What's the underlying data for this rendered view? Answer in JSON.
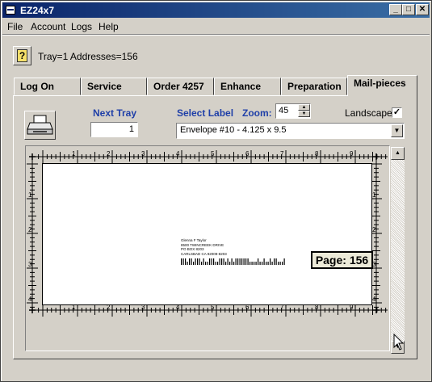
{
  "window": {
    "title": "EZ24x7",
    "controls": {
      "minimize": "_",
      "maximize": "□",
      "close": "✕"
    }
  },
  "menu": {
    "items": [
      "File",
      "Account",
      "Logs",
      "Help"
    ]
  },
  "status": {
    "text": "Tray=1 Addresses=156"
  },
  "tabs": [
    "Log On",
    "Service",
    "Order 4257",
    "Enhance",
    "Preparation",
    "Mail-pieces"
  ],
  "active_tab": "Mail-pieces",
  "controls": {
    "next_tray_label": "Next Tray",
    "next_tray_value": "1",
    "select_label": "Select Label",
    "zoom_label": "Zoom:",
    "zoom_value": "45",
    "landscape_label": "Landscape",
    "landscape_checked": true,
    "label_option": "Envelope #10  - 4.125 x 9.5"
  },
  "ruler": {
    "top_numbers": [
      "1",
      "2",
      "3",
      "4",
      "5",
      "6",
      "7",
      "8",
      "9"
    ],
    "side_numbers": [
      "1",
      "2",
      "3",
      "4"
    ]
  },
  "address": [
    "Glenna F Taylor",
    "8500 TWINCREEK DRIVE",
    "PO BOX 8203",
    "CARLSBAD CA 92009-8203"
  ],
  "page": {
    "label": "Page: 156"
  },
  "icons": {
    "help": "help-question-icon",
    "print": "printer-icon",
    "dropdown": "chevron-down-icon"
  }
}
